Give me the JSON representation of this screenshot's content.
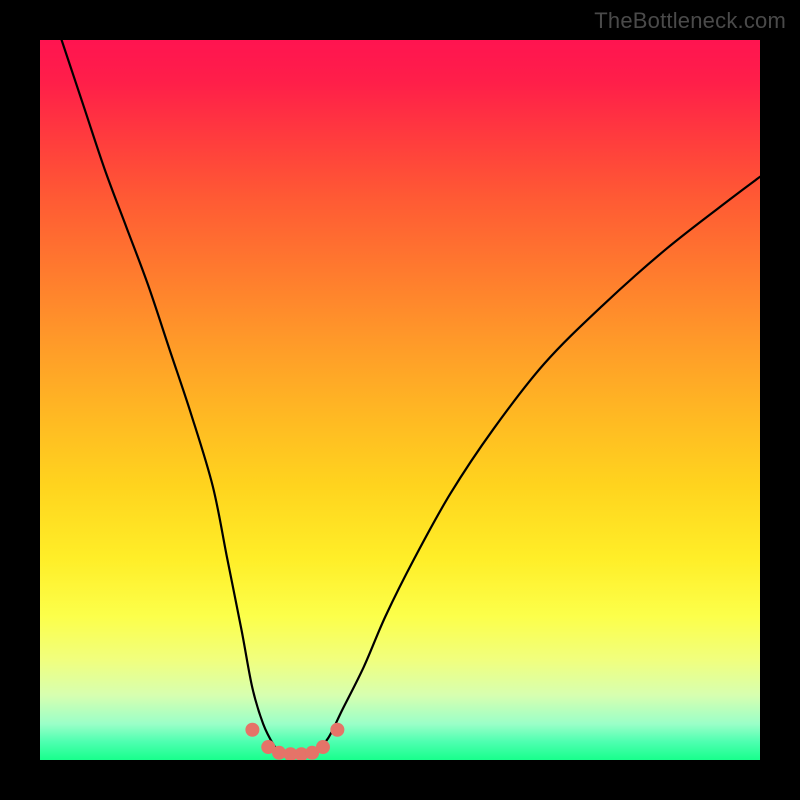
{
  "watermark": "TheBottleneck.com",
  "chart_data": {
    "type": "line",
    "title": "",
    "xlabel": "",
    "ylabel": "",
    "xlim": [
      0,
      100
    ],
    "ylim": [
      0,
      100
    ],
    "series": [
      {
        "name": "left-branch",
        "x": [
          3,
          6,
          9,
          12,
          15,
          18,
          21,
          24,
          26,
          28,
          29.5,
          31,
          32.5,
          33.5
        ],
        "y": [
          100,
          91,
          82,
          74,
          66,
          57,
          48,
          38,
          28,
          18,
          10,
          5,
          2,
          0.8
        ]
      },
      {
        "name": "right-branch",
        "x": [
          38,
          40,
          42,
          45,
          48,
          52,
          57,
          63,
          70,
          78,
          87,
          96,
          100
        ],
        "y": [
          0.8,
          3,
          7,
          13,
          20,
          28,
          37,
          46,
          55,
          63,
          71,
          78,
          81
        ]
      }
    ],
    "floor_markers": {
      "name": "bottom-dots",
      "x": [
        29.5,
        31.7,
        33.2,
        34.8,
        36.3,
        37.8,
        39.3,
        41.3
      ],
      "y": [
        4.2,
        1.8,
        1.0,
        0.8,
        0.8,
        1.0,
        1.8,
        4.2
      ]
    },
    "background_gradient": {
      "top": "#ff1450",
      "bottom": "#18ff8c"
    }
  }
}
